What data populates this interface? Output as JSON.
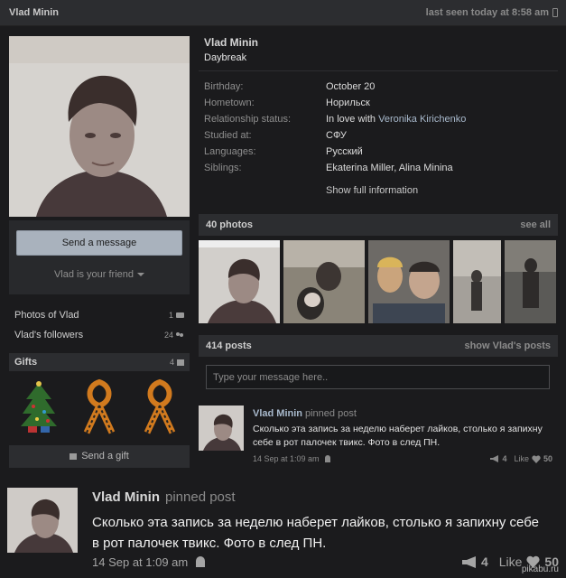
{
  "topbar": {
    "name": "Vlad Minin",
    "last_seen": "last seen today at 8:58 am"
  },
  "actions": {
    "send_message": "Send a message",
    "friend_status": "Vlad is your friend"
  },
  "side_links": [
    {
      "label": "Photos of Vlad",
      "count": "1"
    },
    {
      "label": "Vlad's followers",
      "count": "24"
    }
  ],
  "gifts": {
    "title": "Gifts",
    "count": "4",
    "send_label": "Send a gift"
  },
  "profile": {
    "name": "Vlad Minin",
    "status": "Daybreak",
    "info": [
      {
        "label": "Birthday:",
        "value": "October 20"
      },
      {
        "label": "Hometown:",
        "value": "Норильск"
      },
      {
        "label": "Relationship status:",
        "value": "In love with ",
        "link": "Veronika Kirichenko"
      },
      {
        "label": "Studied at:",
        "value": "СФУ"
      },
      {
        "label": "Languages:",
        "value": "Русский"
      },
      {
        "label": "Siblings:",
        "value": "Ekaterina Miller, Alina Minina"
      }
    ],
    "show_full": "Show full information"
  },
  "photos": {
    "title": "40 photos",
    "see_all": "see all"
  },
  "posts": {
    "title": "414 posts",
    "show_link": "show Vlad's posts",
    "placeholder": "Type your message here.."
  },
  "pinned_post": {
    "author": "Vlad Minin",
    "tag": "pinned post",
    "text": "Сколько эта запись за неделю наберет лайков, столько я запихну себе в рот палочек твикс. Фото в след ПН.",
    "date": "14 Sep at 1:09 am",
    "reposts": "4",
    "like_label": "Like",
    "likes": "50"
  },
  "watermark": "pikabu.ru"
}
